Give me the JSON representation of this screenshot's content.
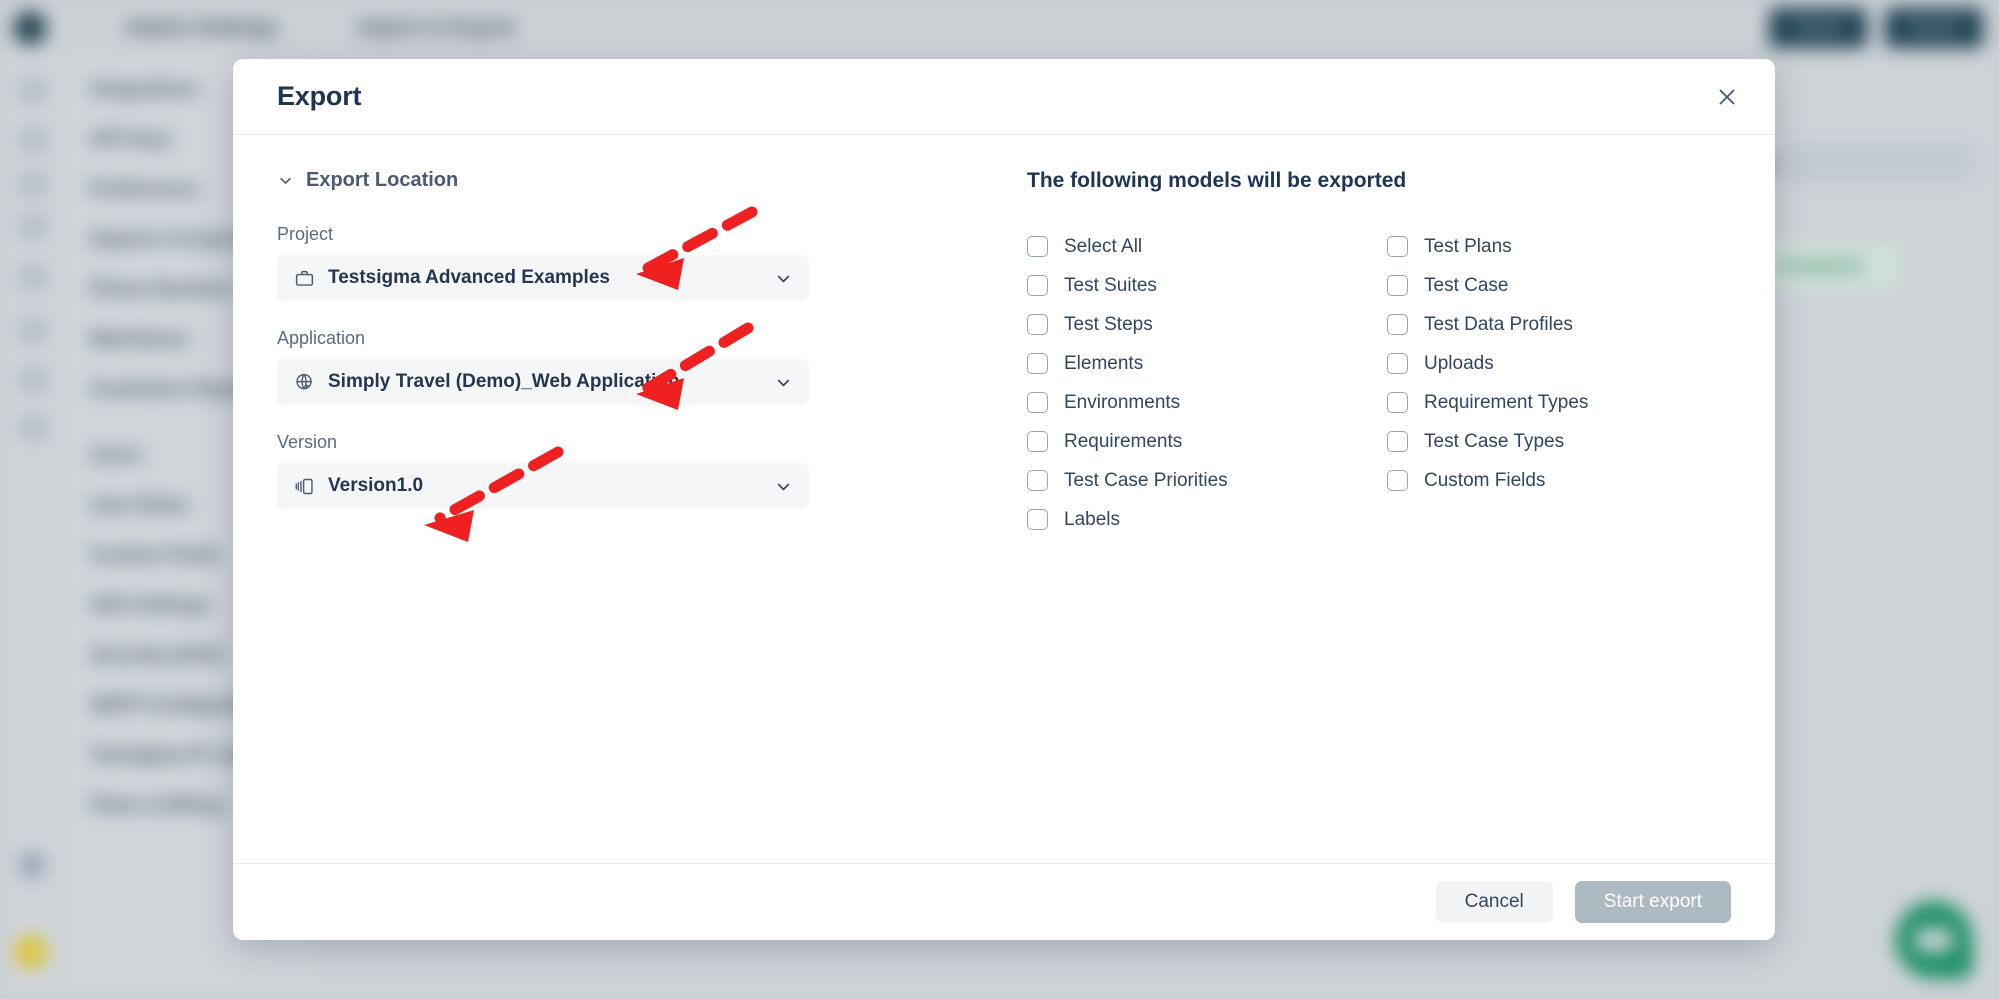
{
  "background": {
    "logo_icon": "app-logo-icon",
    "breadcrumb_1": "Admin Settings",
    "breadcrumb_2": "Import & Export",
    "topbar_button_1": "Import",
    "topbar_button_2": "Export",
    "sidebar_items": [
      "Integrations",
      "API Keys",
      "Preferences",
      "Imports & Exports",
      "Phone Numbers",
      "Mail Boxes",
      "Customise Reports"
    ],
    "sidebar_section_users": "Users",
    "sidebar_items_users": [
      "User Roles",
      "Custom Fields",
      "SSO Settings",
      "Security (SSO)",
      "SMTP Configuration",
      "Testsigma IP Lists",
      "Plans & Billing"
    ],
    "panel_label": "Status",
    "green_chip_label": "Completed",
    "chat_bubble_icon": "chat-bubble-icon"
  },
  "modal": {
    "title": "Export",
    "close_icon": "close-icon",
    "export_location": {
      "label": "Export Location",
      "chevron_icon": "chevron-down-icon",
      "expanded": true
    },
    "fields": [
      {
        "label": "Project",
        "value": "Testsigma Advanced Examples",
        "icon": "briefcase-icon",
        "caret_icon": "chevron-down-icon"
      },
      {
        "label": "Application",
        "value": "Simply Travel (Demo)_Web Application",
        "icon": "globe-pointer-icon",
        "caret_icon": "chevron-down-icon"
      },
      {
        "label": "Version",
        "value": "Version1.0",
        "icon": "versions-icon",
        "caret_icon": "chevron-down-icon"
      }
    ],
    "models": {
      "title": "The following models will be exported",
      "items": [
        {
          "label": "Select All",
          "checked": false
        },
        {
          "label": "Test Plans",
          "checked": false
        },
        {
          "label": "Test Suites",
          "checked": false
        },
        {
          "label": "Test Case",
          "checked": false
        },
        {
          "label": "Test Steps",
          "checked": false
        },
        {
          "label": "Test Data Profiles",
          "checked": false
        },
        {
          "label": "Elements",
          "checked": false
        },
        {
          "label": "Uploads",
          "checked": false
        },
        {
          "label": "Environments",
          "checked": false
        },
        {
          "label": "Requirement Types",
          "checked": false
        },
        {
          "label": "Requirements",
          "checked": false
        },
        {
          "label": "Test Case Types",
          "checked": false
        },
        {
          "label": "Test Case Priorities",
          "checked": false
        },
        {
          "label": "Custom Fields",
          "checked": false
        },
        {
          "label": "Labels",
          "checked": false
        }
      ]
    },
    "footer": {
      "cancel_label": "Cancel",
      "start_export_label": "Start export",
      "start_export_disabled": true
    }
  },
  "annotations": {
    "color": "#ef2020",
    "arrows": [
      {
        "name": "arrow-to-project-field",
        "target": "Project dropdown"
      },
      {
        "name": "arrow-to-application-field",
        "target": "Application dropdown"
      },
      {
        "name": "arrow-to-version-field",
        "target": "Version dropdown"
      }
    ]
  },
  "colors": {
    "modal_bg": "#ffffff",
    "title_text": "#1f3554",
    "field_bg": "#f4f6f8",
    "primary_disabled": "#aebac1",
    "annotation_red": "#ef2020",
    "chat_green": "#1f9068",
    "topbar_btn": "#234558"
  }
}
